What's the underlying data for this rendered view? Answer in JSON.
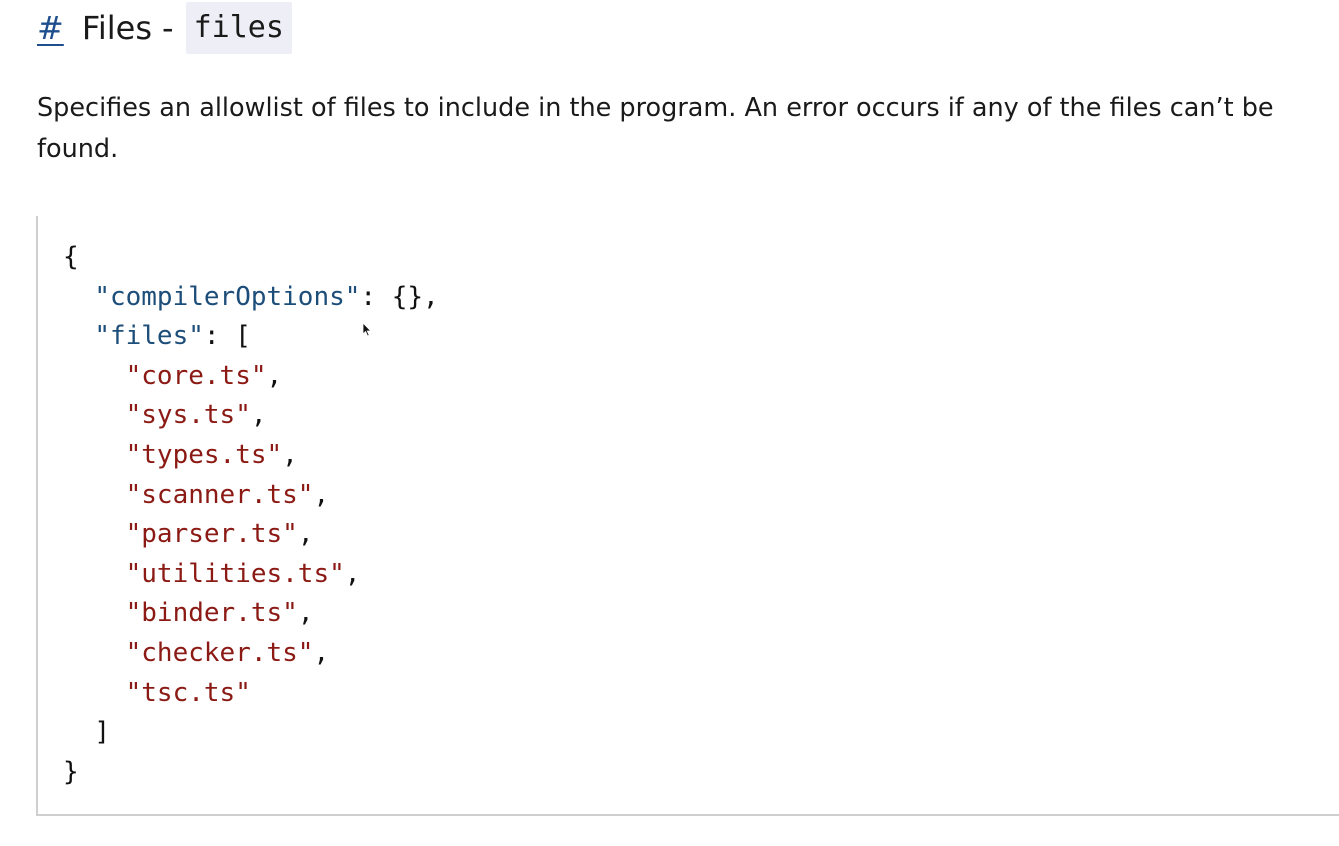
{
  "heading": {
    "anchor": "#",
    "title": "Files",
    "separator": "-",
    "code": "files"
  },
  "description": {
    "line1": "Specifies an allowlist of files to include in the program. An error occurs if any of the files can’t be",
    "line2": "found."
  },
  "code": {
    "open_brace": "{",
    "compiler_options_key": "\"compilerOptions\"",
    "compiler_options_value": ": {},",
    "files_key": "\"files\"",
    "files_open": ": [",
    "file_entries": [
      "\"core.ts\"",
      "\"sys.ts\"",
      "\"types.ts\"",
      "\"scanner.ts\"",
      "\"parser.ts\"",
      "\"utilities.ts\"",
      "\"binder.ts\"",
      "\"checker.ts\"",
      "\"tsc.ts\""
    ],
    "comma": ",",
    "files_close": "]",
    "close_brace": "}"
  },
  "colors": {
    "anchor": "#1e4f8c",
    "json_key": "#1d4e7a",
    "json_string": "#8b1a14",
    "inline_code_bg": "#eeeef6",
    "code_border": "#cfcfcf"
  },
  "icons": {
    "cursor": "mouse-pointer-icon"
  }
}
